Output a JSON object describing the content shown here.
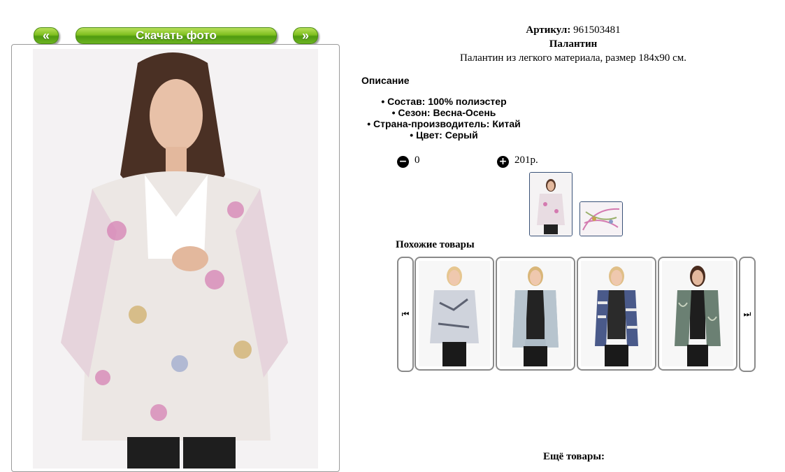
{
  "nav": {
    "prev_label": "«",
    "download_label": "Скачать фото",
    "next_label": "»"
  },
  "product": {
    "article_label": "Артикул:",
    "article_value": "961503481",
    "name": "Палантин",
    "short_description": "Палантин из легкого материала, размер 184x90 см."
  },
  "description": {
    "heading": "Описание",
    "items": [
      "Состав: 100% полиэстер",
      "Сезон: Весна-Осень",
      "Страна-производитель: Китай",
      "Цвет: Серый"
    ]
  },
  "purchase": {
    "quantity": "0",
    "price": "201р."
  },
  "similar": {
    "title": "Похожие товары"
  },
  "more": {
    "title": "Ещё товары:"
  },
  "icons": {
    "prev": "skip-back-icon",
    "next": "skip-forward-icon",
    "minus": "minus-circle-icon",
    "plus": "plus-circle-icon"
  },
  "colors": {
    "button_green": "#6cb321",
    "thumb_border": "#3a5278",
    "card_border": "#8a8a8a"
  }
}
